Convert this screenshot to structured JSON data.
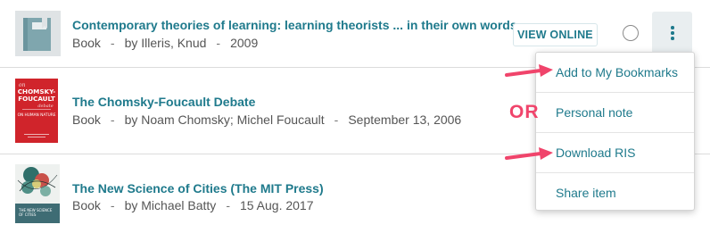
{
  "results": [
    {
      "title": "Contemporary theories of learning: learning theorists ... in their own words",
      "type": "Book",
      "author": "by Illeris, Knud",
      "date": "2009",
      "thumbnail_icon": "book-placeholder-icon"
    },
    {
      "title": "The Chomsky-Foucault Debate",
      "type": "Book",
      "author": "by Noam Chomsky; Michel Foucault",
      "date": "September 13, 2006",
      "cover": {
        "small_top": "on",
        "line1": "CHOMSKY-",
        "line2": "FOUCAULT",
        "small_mid": "debate",
        "subtitle": "ON HUMAN NATURE"
      }
    },
    {
      "title": "The New Science of Cities (The MIT Press)",
      "type": "Book",
      "author": "by Michael Batty",
      "date": "15 Aug. 2017",
      "cover": {
        "text1": "THE NEW SCIENCE",
        "text2": "OF CITIES"
      }
    }
  ],
  "actions": {
    "view_online": "VIEW ONLINE",
    "more_icon": "more-vertical-icon",
    "select_icon": "radio-circle-icon"
  },
  "menu": {
    "items": [
      "Add to My Bookmarks",
      "Personal note",
      "Download RIS",
      "Share item"
    ]
  },
  "annotation": {
    "or_text": "OR",
    "arrow_color": "#f0446b"
  },
  "colors": {
    "link": "#1f7a8c",
    "accent": "#f0446b",
    "kebab_bg": "#e9eef0"
  }
}
